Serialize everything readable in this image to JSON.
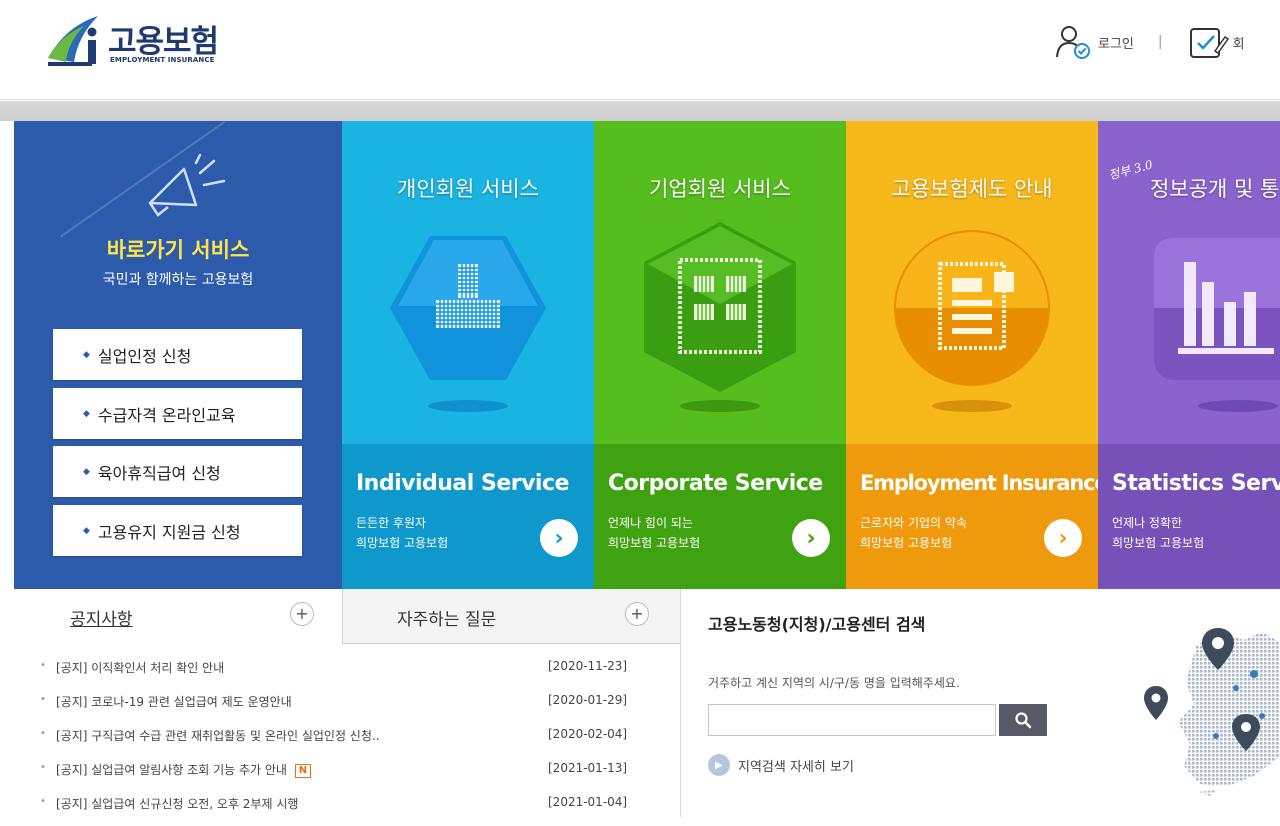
{
  "header": {
    "logo_title": "고용보험",
    "logo_sub": "EMPLOYMENT INSURANCE",
    "login_label": "로그인",
    "separator": "|",
    "register_label": "회"
  },
  "quick": {
    "title": "바로가기 서비스",
    "subtitle": "국민과 함께하는 고용보험",
    "bullet": "◆",
    "buttons": [
      "실업인정 신청",
      "수급자격 온라인교육",
      "육아휴직급여 신청",
      "고용유지 지원금 신청"
    ]
  },
  "services": [
    {
      "title": "개인회원 서비스",
      "en": "Individual Service",
      "desc1": "든든한 후원자",
      "desc2": "희망보험 고용보험",
      "top_color": "#1ab4e3",
      "bottom_color": "#0f98cc",
      "icon": "person-icon"
    },
    {
      "title": "기업회원 서비스",
      "en": "Corporate Service",
      "desc1": "언제나 힘이 되는",
      "desc2": "희망보험 고용보험",
      "top_color": "#55bd1d",
      "bottom_color": "#3fa311",
      "icon": "building-icon"
    },
    {
      "title": "고용보험제도 안내",
      "en": "Employment Insurance",
      "desc1": "근로자와 기업의 약속",
      "desc2": "희망보험 고용보험",
      "top_color": "#f7b81a",
      "bottom_color": "#ee9a0c",
      "icon": "document-icon"
    },
    {
      "title": "정보공개 및 통",
      "en": "Statistics Servi",
      "desc1": "언제나 정확한",
      "desc2": "희망보험 고용보험",
      "badge": "정부 3.0",
      "top_color": "#8a63cc",
      "bottom_color": "#7551b8",
      "icon": "bar-chart-icon"
    }
  ],
  "tabs": {
    "notice": "공지사항",
    "faq": "자주하는 질문",
    "plus": "+"
  },
  "notices": [
    {
      "title": "[공지] 이직확인서 처리 확인 안내",
      "date": "[2020-11-23]",
      "new": false
    },
    {
      "title": "[공지] 코로나-19 관련 실업급여 제도 운영안내",
      "date": "[2020-01-29]",
      "new": false
    },
    {
      "title": "[공지] 구직급여 수급 관련 재취업활동 및 온라인 실업인정 신청..",
      "date": "[2020-02-04]",
      "new": false
    },
    {
      "title": "[공지] 실업급여 알림사항 조회 기능 추가 안내",
      "date": "[2021-01-13]",
      "new": true,
      "badge": "N"
    },
    {
      "title": "[공지] 실업급여 신규신청 오전, 오후 2부제 시행",
      "date": "[2021-01-04]",
      "new": false
    }
  ],
  "search": {
    "title": "고용노동청(지청)/고용센터 검색",
    "description": "거주하고 계신 지역의 시/구/동 명을 입력해주세요.",
    "input_value": "",
    "more_label": "지역검색 자세히 보기"
  },
  "colors": {
    "quick_bg": "#2d5bab",
    "quick_title": "#ffe54a",
    "new_badge": "#ee6a1a"
  }
}
